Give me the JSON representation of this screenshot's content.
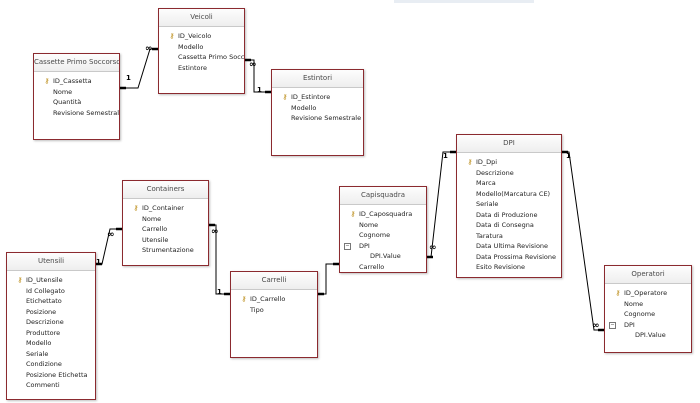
{
  "tables": [
    {
      "id": "cassette",
      "title": "Cassette Primo Soccorso",
      "fields": [
        {
          "name": "ID_Cassetta",
          "key": true
        },
        {
          "name": "Nome"
        },
        {
          "name": "Quantità"
        },
        {
          "name": "Revisione Semestrale"
        }
      ]
    },
    {
      "id": "veicoli",
      "title": "Veicoli",
      "fields": [
        {
          "name": "ID_Veicolo",
          "key": true
        },
        {
          "name": "Modello"
        },
        {
          "name": "Cassetta Primo Soccorso"
        },
        {
          "name": "Estintore"
        }
      ]
    },
    {
      "id": "estintori",
      "title": "Estintori",
      "fields": [
        {
          "name": "ID_Estintore",
          "key": true
        },
        {
          "name": "Modello"
        },
        {
          "name": "Revisione Semestrale"
        }
      ]
    },
    {
      "id": "dpi",
      "title": "DPI",
      "fields": [
        {
          "name": "ID_Dpi",
          "key": true
        },
        {
          "name": "Descrizione"
        },
        {
          "name": "Marca"
        },
        {
          "name": "Modello(Marcatura CE)"
        },
        {
          "name": "Seriale"
        },
        {
          "name": "Data di Produzione"
        },
        {
          "name": "Data di Consegna"
        },
        {
          "name": "Taratura"
        },
        {
          "name": "Data Ultima Revisione"
        },
        {
          "name": "Data Prossima Revisione"
        },
        {
          "name": "Esito Revisione"
        }
      ]
    },
    {
      "id": "containers",
      "title": "Containers",
      "fields": [
        {
          "name": "ID_Container",
          "key": true
        },
        {
          "name": "Nome"
        },
        {
          "name": "Carrello"
        },
        {
          "name": "Utensile"
        },
        {
          "name": "Strumentazione"
        }
      ]
    },
    {
      "id": "capisquadra",
      "title": "Capisquadra",
      "fields": [
        {
          "name": "ID_Caposquadra",
          "key": true
        },
        {
          "name": "Nome"
        },
        {
          "name": "Cognome"
        },
        {
          "name": "DPI",
          "expand": "⊟"
        },
        {
          "name": "DPI.Value",
          "sub": true
        },
        {
          "name": "Carrello"
        }
      ]
    },
    {
      "id": "utensili",
      "title": "Utensili",
      "fields": [
        {
          "name": "ID_Utensile",
          "key": true
        },
        {
          "name": "Id Collegato"
        },
        {
          "name": "Etichettato"
        },
        {
          "name": "Posizione"
        },
        {
          "name": "Descrizione"
        },
        {
          "name": "Produttore"
        },
        {
          "name": "Modello"
        },
        {
          "name": "Seriale"
        },
        {
          "name": "Condizione"
        },
        {
          "name": "Posizione Etichetta"
        },
        {
          "name": "Commenti"
        }
      ]
    },
    {
      "id": "carrelli",
      "title": "Carrelli",
      "fields": [
        {
          "name": "ID_Carrello",
          "key": true
        },
        {
          "name": "Tipo"
        }
      ]
    },
    {
      "id": "operatori",
      "title": "Operatori",
      "fields": [
        {
          "name": "ID_Operatore",
          "key": true
        },
        {
          "name": "Nome"
        },
        {
          "name": "Cognome"
        },
        {
          "name": "DPI",
          "expand": "⊟"
        },
        {
          "name": "DPI.Value",
          "sub": true
        }
      ]
    }
  ],
  "relationships": [
    {
      "from": "cassette",
      "to": "veicoli",
      "one_label": "1",
      "many_label": "∞"
    },
    {
      "from": "veicoli",
      "to": "estintori",
      "one_label": "1",
      "many_label": "∞"
    },
    {
      "from": "containers",
      "to": "utensili",
      "one_label": "1",
      "many_label": "∞"
    },
    {
      "from": "containers",
      "to": "carrelli",
      "one_label": "1",
      "many_label": "∞"
    },
    {
      "from": "carrelli",
      "to": "capisquadra",
      "one_label": "",
      "many_label": ""
    },
    {
      "from": "dpi",
      "to": "capisquadra",
      "one_label": "1",
      "many_label": "∞"
    },
    {
      "from": "dpi",
      "to": "operatori",
      "one_label": "1",
      "many_label": "∞"
    }
  ],
  "colors": {
    "table_border": "#8b2a2f",
    "key_icon": "#b8860b",
    "line": "#000000"
  }
}
